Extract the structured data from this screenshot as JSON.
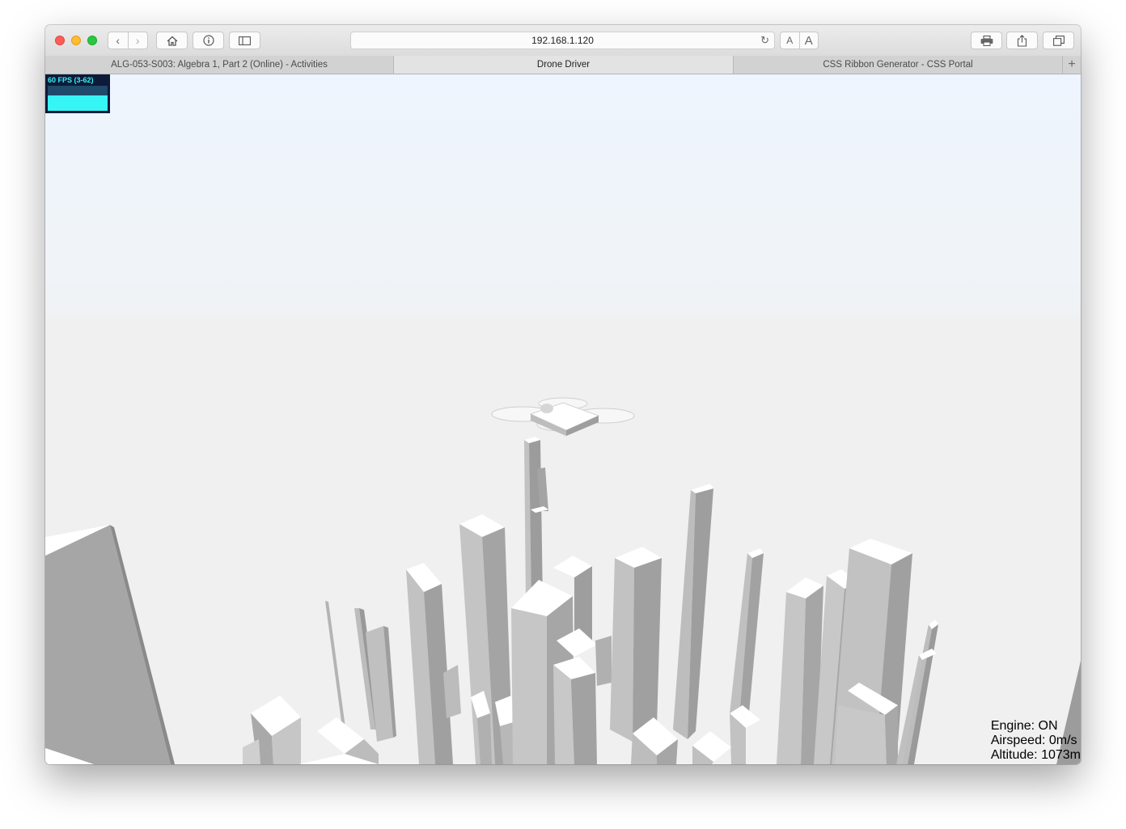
{
  "browser": {
    "address": "192.168.1.120",
    "tabs": [
      {
        "label": "ALG-053-S003: Algebra 1, Part 2 (Online) - Activities"
      },
      {
        "label": "Drone Driver"
      },
      {
        "label": "CSS Ribbon Generator - CSS Portal"
      }
    ],
    "font_small_label": "A",
    "font_large_label": "A",
    "new_tab_label": "+"
  },
  "fps_meter": {
    "label": "60 FPS (3-62)",
    "fps": 60,
    "min": 3,
    "max": 62,
    "fill_fraction": 0.6
  },
  "hud": {
    "engine": "Engine: ON",
    "airspeed": "Airspeed: 0m/s",
    "altitude": "Altitude: 1073m"
  },
  "colors": {
    "sky_top": "#eef5fe",
    "ground": "#f0f0f0",
    "fps_bg": "#0d1a3a",
    "fps_accent": "#36f5f5"
  }
}
